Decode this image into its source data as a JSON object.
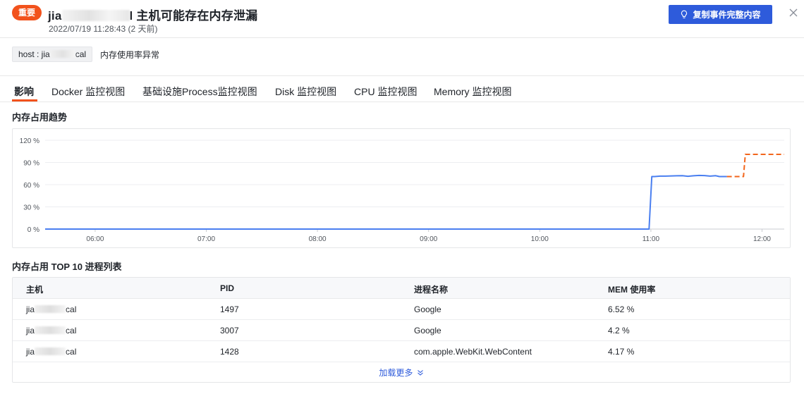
{
  "header": {
    "severity": "重要",
    "title_prefix": "jia",
    "title_suffix": "l 主机可能存在内存泄漏",
    "subtitle": "2022/07/19 11:28:43 (2 天前)",
    "copy_button": "复制事件完整内容"
  },
  "tag": {
    "host_prefix": "host : jia",
    "host_suffix": "cal",
    "rule": "内存使用率异常"
  },
  "tabs": [
    {
      "label": "影响"
    },
    {
      "label": "Docker 监控视图"
    },
    {
      "label": "基础设施Process监控视图"
    },
    {
      "label": "Disk 监控视图"
    },
    {
      "label": "CPU 监控视图"
    },
    {
      "label": "Memory 监控视图"
    }
  ],
  "chart_section_title": "内存占用趋势",
  "chart_data": {
    "type": "line",
    "y_tick_labels": [
      "120 %",
      "90 %",
      "60 %",
      "30 %",
      "0 %"
    ],
    "y_ticks": [
      120,
      90,
      60,
      30,
      0
    ],
    "ylim": [
      0,
      120
    ],
    "x_tick_labels": [
      "06:00",
      "07:00",
      "08:00",
      "09:00",
      "10:00",
      "11:00",
      "12:00"
    ],
    "x_ticks": [
      360,
      420,
      480,
      540,
      600,
      660,
      720
    ],
    "xlim": [
      333,
      732
    ],
    "series": [
      {
        "color": "#4a7ff0",
        "style": "solid",
        "points": [
          [
            333,
            0
          ],
          [
            659,
            0
          ],
          [
            660.5,
            71
          ],
          [
            662,
            71
          ],
          [
            665,
            71.5
          ],
          [
            668,
            71.5
          ],
          [
            671,
            71.8
          ],
          [
            674,
            72
          ],
          [
            677,
            72.2
          ],
          [
            680,
            71.3
          ],
          [
            683,
            72
          ],
          [
            686,
            72.5
          ],
          [
            689,
            72.3
          ],
          [
            692,
            71.5
          ],
          [
            695,
            72.1
          ],
          [
            697,
            71
          ],
          [
            701,
            71
          ]
        ]
      },
      {
        "color": "#f2661c",
        "style": "dashed",
        "points": [
          [
            701,
            71
          ],
          [
            710,
            71
          ],
          [
            711,
            101
          ],
          [
            732,
            101
          ]
        ]
      }
    ],
    "grid": true
  },
  "table_section_title": "内存占用 TOP 10 进程列表",
  "table": {
    "headers": [
      "主机",
      "PID",
      "进程名称",
      "MEM 使用率"
    ],
    "rows": [
      {
        "host_prefix": "jia",
        "host_suffix": "cal",
        "pid": "1497",
        "process": "Google",
        "mem": "6.52 %"
      },
      {
        "host_prefix": "jia",
        "host_suffix": "cal",
        "pid": "3007",
        "process": "Google",
        "mem": "4.2 %"
      },
      {
        "host_prefix": "jia",
        "host_suffix": "cal",
        "pid": "1428",
        "process": "com.apple.WebKit.WebContent",
        "mem": "4.17 %"
      }
    ],
    "load_more": "加载更多"
  }
}
